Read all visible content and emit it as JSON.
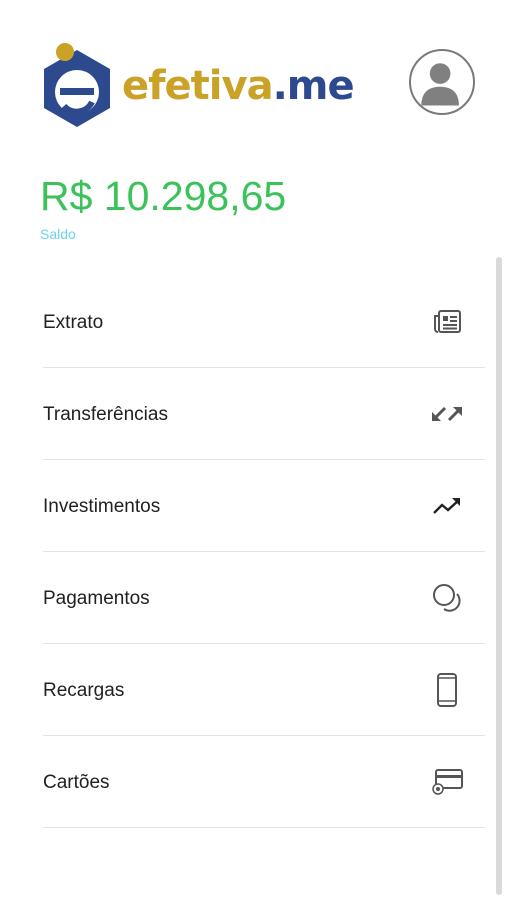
{
  "brand": {
    "part1": "efetiva",
    "part2": ".me",
    "color_primary": "#c9a227",
    "color_secondary": "#2e4a8f"
  },
  "account": {
    "balance": "R$ 10.298,65",
    "balance_label": "Saldo",
    "balance_color": "#3cc25a"
  },
  "avatar_icon": "user-avatar-icon",
  "menu": {
    "items": [
      {
        "label": "Extrato",
        "icon": "newspaper-icon"
      },
      {
        "label": "Transferências",
        "icon": "transfer-arrows-icon"
      },
      {
        "label": "Investimentos",
        "icon": "trending-up-icon"
      },
      {
        "label": "Pagamentos",
        "icon": "coins-icon"
      },
      {
        "label": "Recargas",
        "icon": "phone-icon"
      },
      {
        "label": "Cartões",
        "icon": "credit-card-icon"
      }
    ]
  }
}
